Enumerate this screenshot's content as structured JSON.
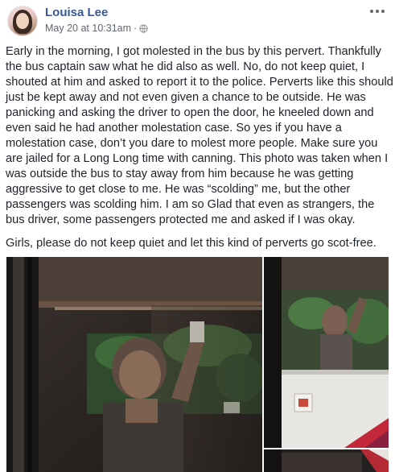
{
  "post": {
    "author": "Louisa Lee",
    "timestamp": "May 20 at 10:31am",
    "privacy_icon": "globe-icon",
    "more_icon": "more-horizontal-icon",
    "body": [
      "Early in the morning, I got molested in the bus by this pervert. Thankfully the bus captain saw what he did also as well. No, do not keep quiet, I shouted at him and asked to report it to the police. Perverts like this should just be kept away and not even given a chance to be outside. He was panicking and asking the driver to open the door, he kneeled down and even said he had another molestation case. So yes if you have a molestation case, don’t you dare to molest more people. Make sure you are jailed for a Long Long time with canning. This photo was taken when I was outside the bus to stay away from him because he was getting aggressive to get close to me. He was “scolding” me, but the other passengers was scolding him. I am so Glad that even as strangers, the bus driver, some passengers protected me and asked if I was okay.",
      "Girls, please do not keep quiet and let this kind of perverts go scot-free."
    ],
    "photos": [
      {
        "name": "photo-main"
      },
      {
        "name": "photo-side"
      },
      {
        "name": "photo-strip"
      }
    ]
  },
  "colors": {
    "name_link": "#385898",
    "meta_text": "#616770",
    "body_text": "#1d2129"
  }
}
